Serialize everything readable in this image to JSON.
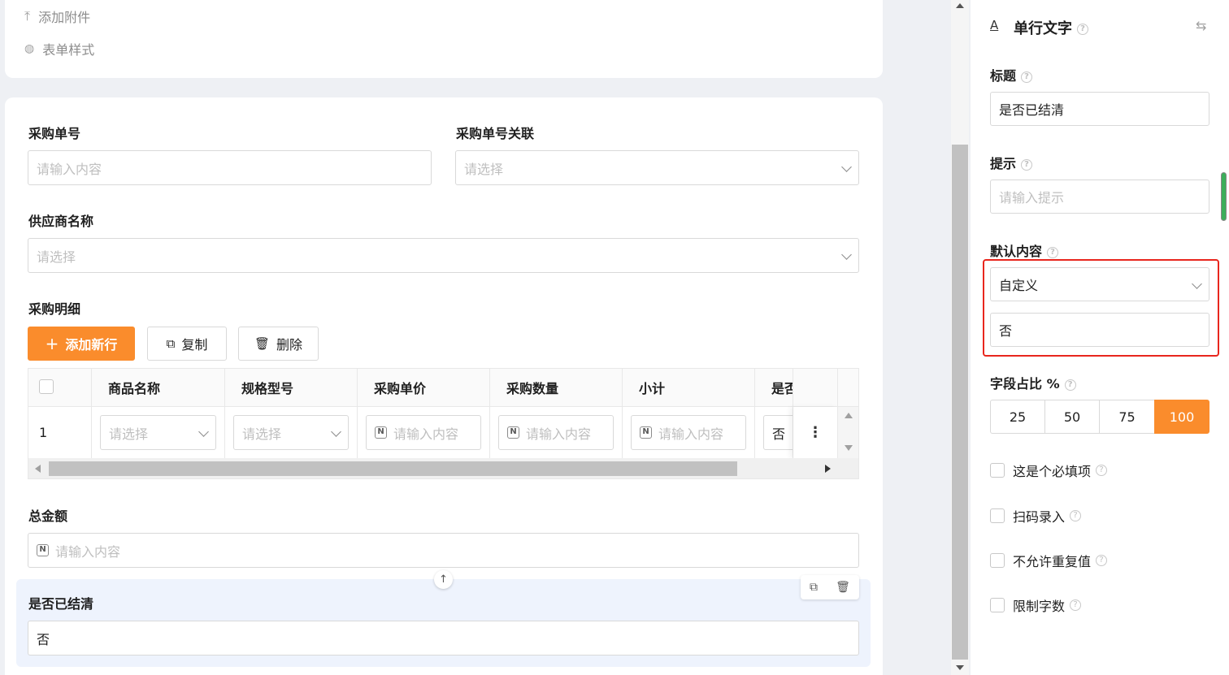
{
  "top_menu": {
    "attach_label": "添加附件",
    "style_label": "表单样式"
  },
  "form": {
    "purchase_no": {
      "label": "采购单号",
      "placeholder": "请输入内容"
    },
    "purchase_link": {
      "label": "采购单号关联",
      "placeholder": "请选择"
    },
    "supplier": {
      "label": "供应商名称",
      "placeholder": "请选择"
    },
    "details": {
      "label": "采购明细",
      "add_row": "添加新行",
      "copy": "复制",
      "delete": "删除",
      "columns": [
        "商品名称",
        "规格型号",
        "采购单价",
        "采购数量",
        "小计",
        "是否"
      ],
      "row_index": "1",
      "row_cells": [
        "请选择",
        "请选择",
        "请输入内容",
        "请输入内容",
        "请输入内容",
        "否"
      ]
    },
    "total": {
      "label": "总金额",
      "placeholder": "请输入内容"
    },
    "settled": {
      "label": "是否已结清",
      "value": "否"
    }
  },
  "panel": {
    "title": "单行文字",
    "title_field": {
      "label": "标题",
      "value": "是否已结清"
    },
    "hint_field": {
      "label": "提示",
      "placeholder": "请输入提示"
    },
    "default_field": {
      "label": "默认内容",
      "mode": "自定义",
      "value": "否"
    },
    "width_field": {
      "label": "字段占比 %",
      "options": [
        "25",
        "50",
        "75",
        "100"
      ],
      "selected": "100"
    },
    "checks": [
      "这是个必填项",
      "扫码录入",
      "不允许重复值",
      "限制字数"
    ]
  },
  "colors": {
    "accent": "#fa8c2c",
    "highlight_border": "#e8261d",
    "selected_bg": "#eef3fd"
  }
}
